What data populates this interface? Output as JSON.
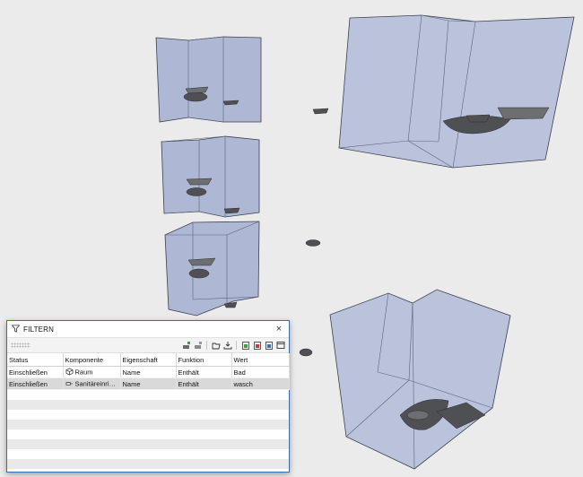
{
  "filter_panel": {
    "title": "FILTERN",
    "close_symbol": "×",
    "toolbar_icons": [
      "add-filter-icon",
      "remove-filter-icon",
      "open-folder-icon",
      "save-icon",
      "clipboard-green-icon",
      "clipboard-red-icon",
      "clipboard-blue-icon",
      "window-icon"
    ],
    "columns": [
      "Status",
      "Komponente",
      "Eigenschaft",
      "Funktion",
      "Wert"
    ],
    "rows": [
      {
        "status": "Einschließen",
        "component_icon": "cube-icon",
        "component": "Raum",
        "property": "Name",
        "function": "Enthält",
        "value": "Bad"
      },
      {
        "status": "Einschließen",
        "component_icon": "fixture-icon",
        "component": "Sanitäreinrichtu…",
        "property": "Name",
        "function": "Enthält",
        "value": "wasch"
      }
    ]
  },
  "colors": {
    "background": "#ebebeb",
    "room_fill": "#a7b3d6",
    "room_edge": "#3b4150",
    "panel_border": "#3d6ea8",
    "selected_row": "#d9d9d9"
  }
}
